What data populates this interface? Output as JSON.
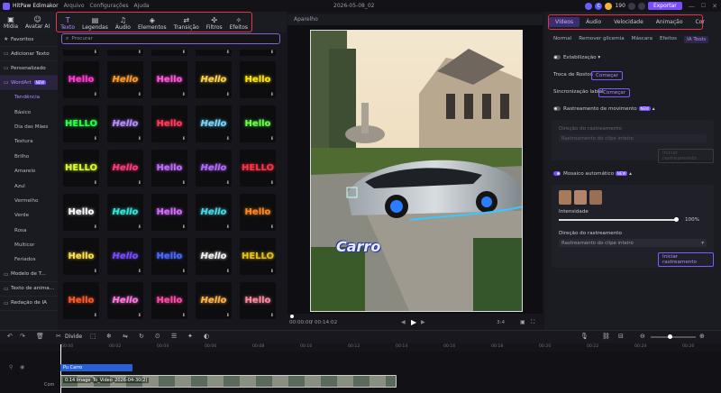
{
  "app": {
    "name": "HitPaw Edimakor",
    "menus": [
      "Arquivo",
      "Configurações",
      "Ajuda"
    ],
    "project_title": "2026-05-08_02",
    "credits": "190",
    "export_label": "Exportar"
  },
  "toolbar": [
    {
      "label": "Mídia",
      "icon": "media-icon"
    },
    {
      "label": "Avatar AI",
      "icon": "avatar-icon"
    },
    {
      "label": "Texto",
      "icon": "text-icon",
      "active": true
    },
    {
      "label": "Legendas",
      "icon": "subtitles-icon"
    },
    {
      "label": "Áudio",
      "icon": "audio-icon"
    },
    {
      "label": "Elementos",
      "icon": "elements-icon"
    },
    {
      "label": "Transição",
      "icon": "transition-icon"
    },
    {
      "label": "Filtros",
      "icon": "filters-icon"
    },
    {
      "label": "Efeitos",
      "icon": "effects-icon"
    }
  ],
  "search": {
    "placeholder": "Procurar"
  },
  "categories": {
    "top": [
      "Favoritos",
      "Adicionar Texto",
      "Personalizado"
    ],
    "wordart": {
      "label": "WordArt",
      "badge": "NEW"
    },
    "wordart_sub": [
      "Tendência",
      "Básico",
      "Dia das Mães",
      "Textura",
      "Brilho",
      "Amarelo",
      "Azul",
      "Vermelho",
      "Verde",
      "Rosa",
      "Multicor",
      "Feriados"
    ],
    "bottom": [
      "Modelo de T...",
      "Texto de anima...",
      "Redação de IA"
    ]
  },
  "tiles": [
    [
      "Hello",
      "Hello",
      "Hello",
      "Hello",
      "Hello"
    ],
    [
      "HELLO",
      "Hello",
      "Hello",
      "Hello",
      "Hello"
    ],
    [
      "HELLO",
      "Hello",
      "Hello",
      "Hello",
      "HELLO"
    ],
    [
      "Hello",
      "Hello",
      "Hello",
      "Hello",
      "Hello"
    ],
    [
      "Hello",
      "Hello",
      "Hello",
      "Hello",
      "HELLO"
    ],
    [
      "Hello",
      "Hello",
      "Hello",
      "Hello",
      "Hello"
    ]
  ],
  "tile_colors": [
    [
      "#ff3bd0",
      "#ff9a2a",
      "#ff55d8",
      "#ffd24a",
      "#ffe600"
    ],
    [
      "#2dff4a",
      "#b78cff",
      "#ff3b5a",
      "#7ad8ff",
      "#66ff4a"
    ],
    [
      "#d8ff2a",
      "#ff3b7a",
      "#c46bff",
      "#b26bff",
      "#ff3344"
    ],
    [
      "#ffffff",
      "#35e6d8",
      "#d86bff",
      "#4ad8e6",
      "#ff8a1a"
    ],
    [
      "#ffe14a",
      "#7a4cff",
      "#4a6bff",
      "#f2f2f2",
      "#e6c21a"
    ],
    [
      "#ff5a2a",
      "#ff7adf",
      "#ff4aa8",
      "#ffb34a",
      "#ff8aa0"
    ]
  ],
  "player": {
    "label": "Aparelho",
    "current_time": "00:00:00",
    "total_time": "00:14:02",
    "aspect": "3:4",
    "overlay_text": "Carro"
  },
  "right_panel": {
    "tabs": [
      "Vídeos",
      "Áudio",
      "Velocidade",
      "Animação",
      "Cor"
    ],
    "subtabs": [
      "Normal",
      "Remover glicemia",
      "Máscara",
      "Efeitos",
      "IA Tools"
    ],
    "stabilization": "Estabilização",
    "face_swap": "Troca de Rostos",
    "face_swap_btn": "Começar",
    "lip_sync": "Sincronização labial",
    "lip_sync_btn": "Começar",
    "motion_tracking": "Rastreamento de movimento",
    "motion_dir_label": "Direção do rastreamento",
    "motion_dir_value": "Rastreamento do clipe inteiro",
    "motion_btn": "Iniciar rastreamento",
    "auto_mosaic": "Mosaico automático",
    "intensity_label": "Intensidade",
    "intensity_value": "100%",
    "intensity_level": 1.0,
    "mosaic_dir_label": "Direção do rastreamento",
    "mosaic_dir_value": "Rastreamento do clipe inteiro",
    "mosaic_btn": "Iniciar rastreamento",
    "new_badge": "NEW"
  },
  "timeline": {
    "split_label": "Divide",
    "ticks": [
      "00:00",
      "00:02",
      "00:04",
      "00:06",
      "00:08",
      "00:10",
      "00:12",
      "00:14",
      "00:16",
      "00:18",
      "00:20",
      "00:22",
      "00:24",
      "00:26"
    ],
    "text_clip": "Pu Carro",
    "video_clip": "0:14 Image_To_Video_2026-04-30(2)",
    "track_label": "Com"
  },
  "colors": {
    "accent": "#7a4cff",
    "highlight_box": "#e6334a",
    "background": "#16161c"
  }
}
